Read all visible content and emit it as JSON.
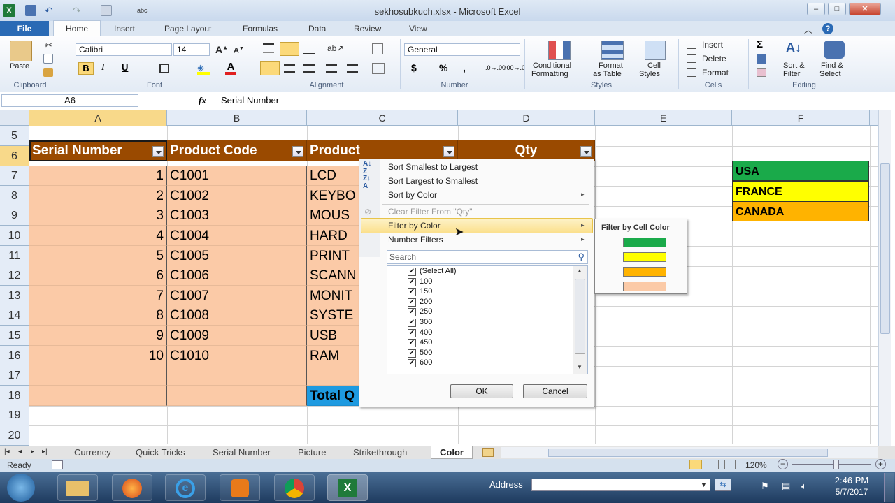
{
  "window": {
    "title": "sekhosubkuch.xlsx - Microsoft Excel"
  },
  "ribbon_tabs": [
    "File",
    "Home",
    "Insert",
    "Page Layout",
    "Formulas",
    "Data",
    "Review",
    "View"
  ],
  "ribbon": {
    "clipboard": {
      "paste": "Paste",
      "group": "Clipboard"
    },
    "font": {
      "name": "Calibri",
      "size": "14",
      "bold": "B",
      "italic": "I",
      "underline": "U",
      "group": "Font"
    },
    "alignment": {
      "group": "Alignment"
    },
    "number": {
      "format": "General",
      "currency": "$",
      "percent": "%",
      "comma": ",",
      "group": "Number"
    },
    "styles": {
      "conditional_1": "Conditional",
      "conditional_2": "Formatting",
      "format_table_1": "Format",
      "format_table_2": "as Table",
      "cell_styles_1": "Cell",
      "cell_styles_2": "Styles",
      "group": "Styles"
    },
    "cells": {
      "insert": "Insert",
      "delete": "Delete",
      "format": "Format",
      "group": "Cells"
    },
    "editing": {
      "sigma": "Σ",
      "sort_1": "Sort &",
      "sort_2": "Filter",
      "find_1": "Find &",
      "find_2": "Select",
      "group": "Editing"
    }
  },
  "formula_bar": {
    "name_box": "A6",
    "fx": "fx",
    "value": "Serial Number"
  },
  "columns": [
    "A",
    "B",
    "C",
    "D",
    "E",
    "F"
  ],
  "rows": [
    "5",
    "6",
    "7",
    "8",
    "9",
    "10",
    "11",
    "12",
    "13",
    "14",
    "15",
    "16",
    "17",
    "18",
    "19",
    "20"
  ],
  "table": {
    "headers": [
      "Serial Number",
      "Product Code",
      "Product",
      "Qty"
    ],
    "serials": [
      "1",
      "2",
      "3",
      "4",
      "5",
      "6",
      "7",
      "8",
      "9",
      "10"
    ],
    "codes": [
      "C1001",
      "C1002",
      "C1003",
      "C1004",
      "C1005",
      "C1006",
      "C1007",
      "C1008",
      "C1009",
      "C1010"
    ],
    "products": [
      "LCD",
      "KEYBO",
      "MOUS",
      "HARD",
      "PRINT",
      "SCANN",
      "MONIT",
      "SYSTE",
      "USB",
      "RAM"
    ],
    "total_label": "Total Q"
  },
  "legend": [
    {
      "label": "USA",
      "color": "#1aaa4a"
    },
    {
      "label": "FRANCE",
      "color": "#ffff00"
    },
    {
      "label": "CANADA",
      "color": "#ffb300"
    }
  ],
  "filter_menu": {
    "sort_asc": "Sort Smallest to Largest",
    "sort_desc": "Sort Largest to Smallest",
    "sort_color": "Sort by Color",
    "clear": "Clear Filter From \"Qty\"",
    "filter_color": "Filter by Color",
    "number_filters": "Number Filters",
    "search_placeholder": "Search",
    "items": [
      "(Select All)",
      "100",
      "150",
      "200",
      "250",
      "300",
      "400",
      "450",
      "500",
      "600"
    ],
    "ok": "OK",
    "cancel": "Cancel"
  },
  "submenu": {
    "title": "Filter by Cell Color",
    "colors": [
      "#1aaa4a",
      "#ffff00",
      "#ffb300",
      "#fbcaa7"
    ]
  },
  "sheet_tabs": [
    "Currency",
    "Quick Tricks",
    "Serial Number",
    "Picture",
    "Strikethrough",
    "Color"
  ],
  "active_sheet": "Color",
  "status": {
    "ready": "Ready",
    "zoom": "120%"
  },
  "taskbar": {
    "address_label": "Address",
    "time": "2:46 PM",
    "date": "5/7/2017"
  }
}
